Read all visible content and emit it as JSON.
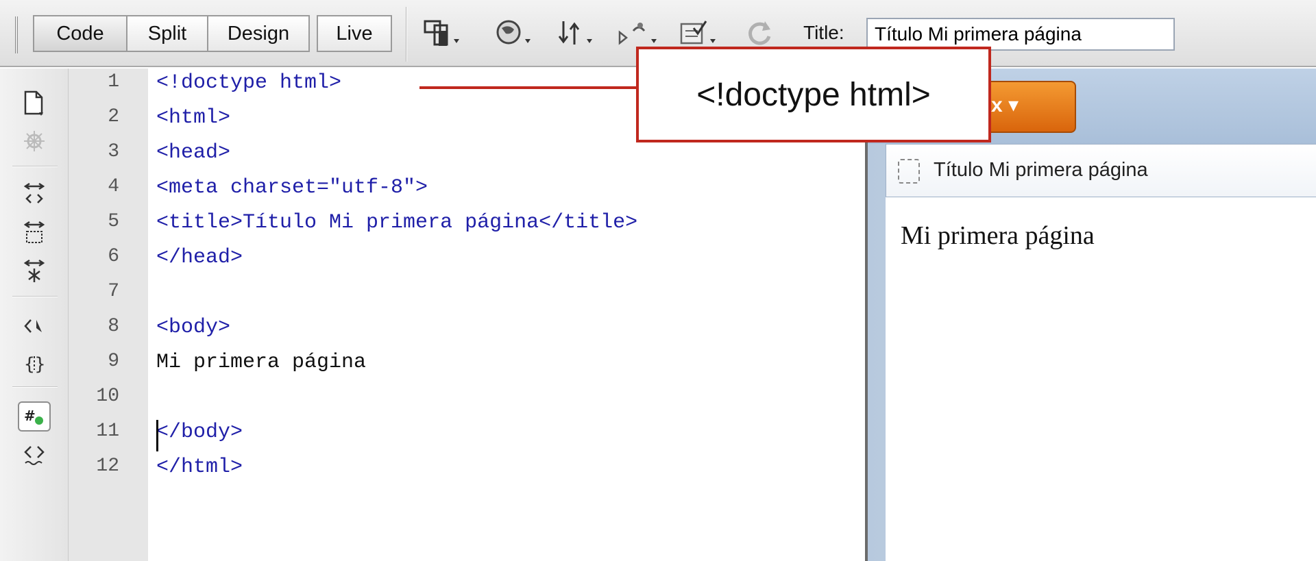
{
  "toolbar": {
    "view_buttons": [
      "Code",
      "Split",
      "Design",
      "Live"
    ],
    "title_label": "Title:",
    "title_value": "Título Mi primera página"
  },
  "code": {
    "line_numbers": [
      "1",
      "2",
      "3",
      "4",
      "5",
      "6",
      "7",
      "8",
      "9",
      "10",
      "11",
      "12"
    ],
    "lines": [
      "<!doctype html>",
      "<html>",
      "<head>",
      "<meta charset=\"utf-8\">",
      "<title>Título Mi primera página</title>",
      "</head>",
      "",
      "<body>",
      "Mi primera página",
      "",
      "</body>",
      "</html>"
    ]
  },
  "preview": {
    "browser_button": "x ▾",
    "tab_title": "Título Mi primera página",
    "page_text": "Mi primera página"
  },
  "callout": {
    "text": "<!doctype html>"
  },
  "colors": {
    "tag_color": "#1f1fa8",
    "callout_red": "#c0281e",
    "browser_orange": "#e8781a"
  }
}
